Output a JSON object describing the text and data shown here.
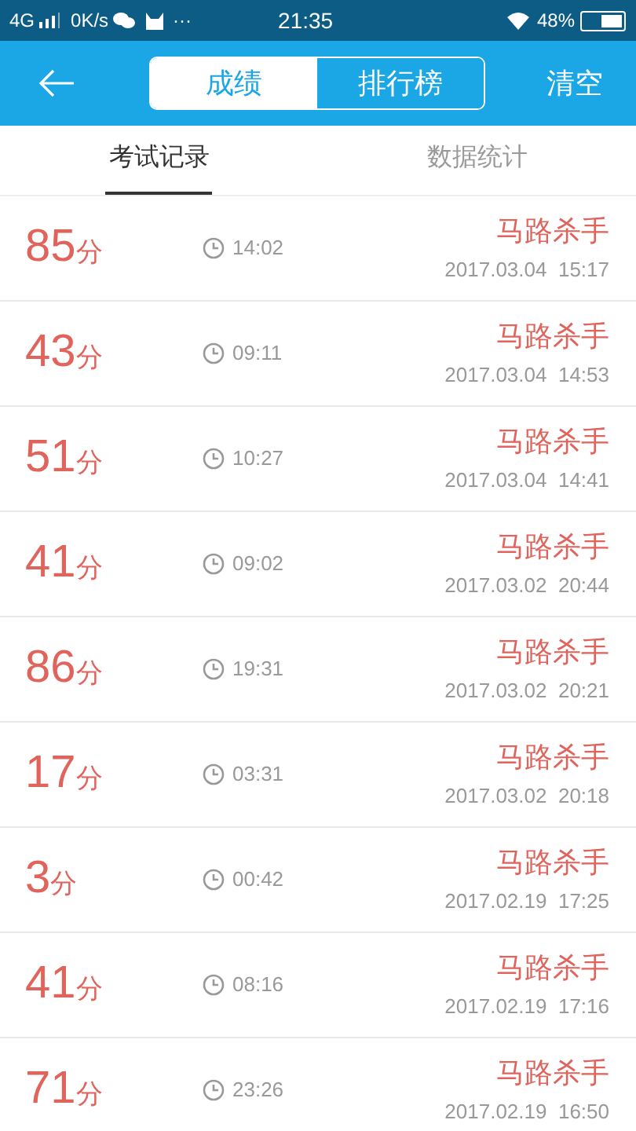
{
  "status_bar": {
    "network": "4G",
    "speed": "0K/s",
    "more": "···",
    "time": "21:35",
    "battery": "48%"
  },
  "header": {
    "segments": [
      {
        "label": "成绩",
        "selected": true
      },
      {
        "label": "排行榜",
        "selected": false
      }
    ],
    "action": "清空"
  },
  "tabs": [
    {
      "label": "考试记录",
      "selected": true
    },
    {
      "label": "数据统计",
      "selected": false
    }
  ],
  "records": [
    {
      "score": "85",
      "unit": "分",
      "duration": "14:02",
      "name": "马路杀手",
      "date": "2017.03.04  15:17"
    },
    {
      "score": "43",
      "unit": "分",
      "duration": "09:11",
      "name": "马路杀手",
      "date": "2017.03.04  14:53"
    },
    {
      "score": "51",
      "unit": "分",
      "duration": "10:27",
      "name": "马路杀手",
      "date": "2017.03.04  14:41"
    },
    {
      "score": "41",
      "unit": "分",
      "duration": "09:02",
      "name": "马路杀手",
      "date": "2017.03.02  20:44"
    },
    {
      "score": "86",
      "unit": "分",
      "duration": "19:31",
      "name": "马路杀手",
      "date": "2017.03.02  20:21"
    },
    {
      "score": "17",
      "unit": "分",
      "duration": "03:31",
      "name": "马路杀手",
      "date": "2017.03.02  20:18"
    },
    {
      "score": "3",
      "unit": "分",
      "duration": "00:42",
      "name": "马路杀手",
      "date": "2017.02.19  17:25"
    },
    {
      "score": "41",
      "unit": "分",
      "duration": "08:16",
      "name": "马路杀手",
      "date": "2017.02.19  17:16"
    },
    {
      "score": "71",
      "unit": "分",
      "duration": "23:26",
      "name": "马路杀手",
      "date": "2017.02.19  16:50"
    }
  ]
}
